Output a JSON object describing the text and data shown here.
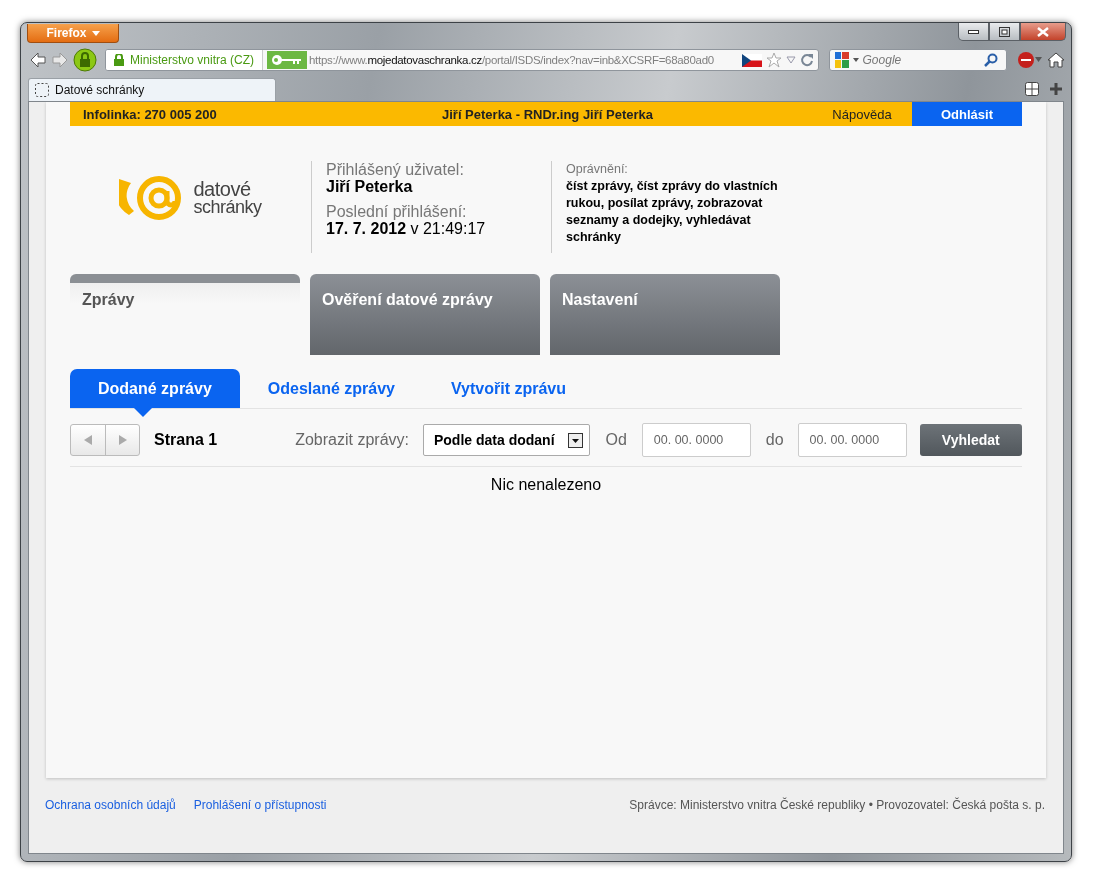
{
  "browser": {
    "menu_button": "Firefox",
    "site_identity": "Ministerstvo vnitra (CZ)",
    "url": {
      "scheme": "https://www.",
      "domain": "mojedatovaschranka.cz",
      "path": "/portal/ISDS/index?nav=inb&XCSRF=68a80ad0"
    },
    "search": {
      "placeholder": "Google"
    },
    "tabs": [
      {
        "label": "Datové schránky",
        "selected": true
      }
    ]
  },
  "top_bar": {
    "hotline": "Infolinka: 270 005 200",
    "user": "Jiří Peterka - RNDr.ing Jiří Peterka",
    "help": "Nápověda",
    "logout": "Odhlásit"
  },
  "logo": {
    "line_1": "datové",
    "line_2": "schránky"
  },
  "user_info": {
    "user_label": "Přihlášený uživatel:",
    "user_name": "Jiří Peterka",
    "last_login_label": "Poslední přihlášení:",
    "last_login": "**17. 7. 2012** v 21:49:17"
  },
  "permissions": {
    "label": "Oprávnění:",
    "value": "číst zprávy, číst zprávy do vlastních rukou, posílat zprávy, zobrazovat seznamy a dodejky, vyhledávat schránky"
  },
  "main_tabs": [
    {
      "label": "Zprávy",
      "selected": true
    },
    {
      "label": "Ověření datové zprávy",
      "selected": false
    },
    {
      "label": "Nastavení",
      "selected": false
    }
  ],
  "sub_tabs": [
    {
      "label": "Dodané zprávy",
      "selected": true
    },
    {
      "label": "Odeslané zprávy",
      "selected": false
    },
    {
      "label": "Vytvořit zprávu",
      "selected": false
    }
  ],
  "toolbar": {
    "page": "Strana 1",
    "show_label": "Zobrazit zprávy:",
    "show_value": "Podle data dodaní",
    "from_label": "Od",
    "from_value": "00. 00. 0000",
    "to_label": "do",
    "to_value": "00. 00. 0000",
    "search_button": "Vyhledat"
  },
  "empty_message": "Nic nenalezeno",
  "footer": {
    "links": [
      "Ochrana osobních údajů",
      "Prohlášení o přístupnosti"
    ],
    "text": "Správce: Ministerstvo vnitra České republiky • Provozovatel: Česká pošta s. p."
  }
}
